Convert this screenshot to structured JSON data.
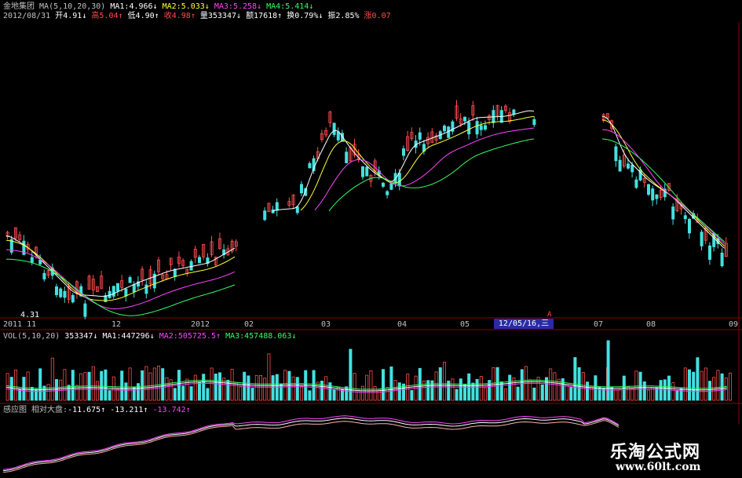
{
  "header": {
    "stock_name": "金地集团",
    "ma_label": "MA(5,10,20,30)",
    "ma1": "MA1:4.966",
    "ma1_arrow": "↓",
    "ma2": "MA2:5.033",
    "ma2_arrow": "↓",
    "ma3": "MA3:5.258",
    "ma3_arrow": "↓",
    "ma4": "MA4:5.414",
    "ma4_arrow": "↓"
  },
  "quote": {
    "date": "2012/08/31",
    "open": "开4.91",
    "open_arrow": "↓",
    "high": "高5.04",
    "high_arrow": "↑",
    "low": "低4.90",
    "low_arrow": "↑",
    "close": "收4.98",
    "close_arrow": "↑",
    "volume": "量353347",
    "volume_arrow": "↓",
    "amount": "额17618",
    "amount_arrow": "↑",
    "turnover": "换0.79%",
    "turnover_arrow": "↓",
    "amplitude": "振2.85%",
    "change": "涨0.07"
  },
  "price_panel": {
    "low_marker": "4.31",
    "last_candle_marker": "A"
  },
  "x_axis": {
    "labels": [
      "2011 11",
      "12",
      "2012",
      "02",
      "03",
      "04",
      "05",
      "07",
      "08",
      "09"
    ],
    "cursor_date": "12/05/16,三"
  },
  "volume_panel": {
    "label": "VOL(5,10,20)",
    "value": "353347",
    "value_arrow": "↓",
    "ma1": "MA1:447296",
    "ma1_arrow": "↓",
    "ma2": "MA2:505725.5",
    "ma2_arrow": "↑",
    "ma3": "MA3:457488.063",
    "ma3_arrow": "↓"
  },
  "indicator_panel": {
    "name": "感应图",
    "label": "相对大盘",
    "v1": "-11.675",
    "v1_arrow": "↑",
    "v2": "-13.211",
    "v2_arrow": "↑",
    "v3": "-13.742",
    "v3_arrow": "↑"
  },
  "watermark": {
    "cn": "乐淘公式网",
    "url": "www.60lt.com"
  },
  "colors": {
    "background": "#000000",
    "up_candle": "#ff4d4d",
    "down_candle": "#44e0e0",
    "ma_white": "#ffffff",
    "ma_yellow": "#ffff33",
    "ma_magenta": "#ff44ff",
    "ma_green": "#33ff66",
    "grid": "#8b0000"
  }
}
